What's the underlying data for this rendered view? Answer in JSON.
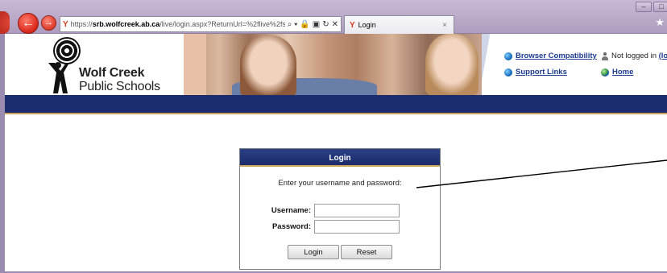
{
  "browser": {
    "address_prefix": "https://",
    "address_domain": "srb.wolfcreek.ab.ca",
    "address_path": "/live/login.aspx?ReturnUrl=%2flive%2fservlet%2f",
    "search_icon": "search-icon",
    "tab_title": "Login",
    "tab_close": "×",
    "back_icon": "←",
    "forward_icon": "→",
    "star_icon": "★",
    "minimize": "–",
    "maximize": "□",
    "address_tools": [
      "⌕ ▾",
      "🔒",
      "▣",
      "↻",
      "✕"
    ]
  },
  "site": {
    "logo_line1": "Wolf Creek",
    "logo_line2": "Public Schools",
    "links": {
      "browser_compat": "Browser Compatibility",
      "support": "Support Links",
      "home": "Home",
      "status": "Not logged in",
      "login_link": "(logi"
    }
  },
  "login": {
    "title": "Login",
    "prompt": "Enter your username and password:",
    "username_label": "Username:",
    "password_label": "Password:",
    "username_value": "",
    "password_value": "",
    "login_button": "Login",
    "reset_button": "Reset"
  },
  "colors": {
    "nav_bar": "#1b2d6e",
    "accent_gold": "#c9a35a",
    "link_blue": "#1b3b8e"
  }
}
